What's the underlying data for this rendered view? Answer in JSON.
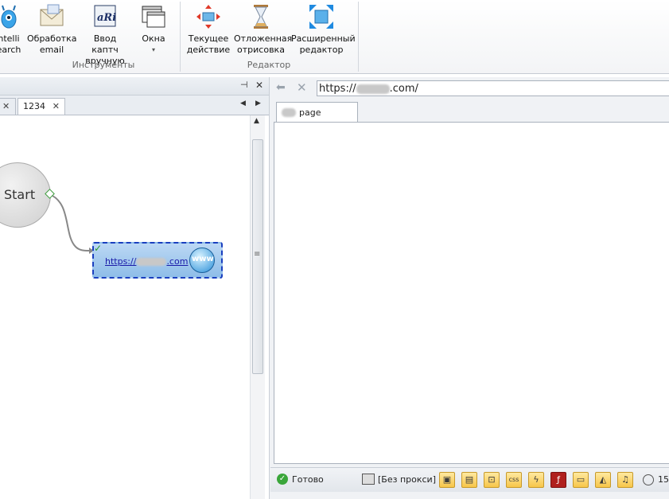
{
  "ribbon": {
    "tools_group": {
      "label": "Инструменты",
      "buttons": [
        {
          "line1": "ntelli",
          "line2": "earch",
          "icon": "intellisearch-icon"
        },
        {
          "line1": "Обработка",
          "line2": "email",
          "icon": "email-envelope-icon"
        },
        {
          "line1": "Ввод каптч",
          "line2": "вручную",
          "icon": "captcha-icon"
        },
        {
          "line1": "Окна",
          "line2": "▾",
          "icon": "windows-icon"
        }
      ]
    },
    "editor_group": {
      "label": "Редактор",
      "buttons": [
        {
          "line1": "Текущее",
          "line2": "действие",
          "icon": "current-action-icon"
        },
        {
          "line1": "Отложенная",
          "line2": "отрисовка",
          "icon": "hourglass-icon"
        },
        {
          "line1": "Расширенный",
          "line2": "редактор",
          "icon": "expand-arrows-icon"
        }
      ]
    }
  },
  "left_panel": {
    "pin_glyph": "⊣",
    "close_glyph": "✕",
    "tab_close_glyph": "✕",
    "tabs": [
      {
        "label": "",
        "close": "✕"
      },
      {
        "label": "1234",
        "close": "✕"
      }
    ],
    "nav_prev": "◀",
    "nav_next": "▶",
    "scroll_up": "▲",
    "scroll_grip": "≡",
    "start_node": "Start",
    "url_node": {
      "prefix": "https://",
      "suffix": ".com",
      "badge": "www"
    }
  },
  "browser": {
    "back_glyph": "⬅",
    "stop_glyph": "✕",
    "url_prefix": "https://",
    "url_suffix": ".com/",
    "tab_label": "page"
  },
  "status_bar": {
    "status": "Готово",
    "proxy": "[Без прокси]",
    "time_prefix": "15",
    "icons": [
      "image-icon",
      "window-icon",
      "frames-icon",
      "css-icon",
      "lightning-icon",
      "flash-icon",
      "media-player-icon",
      "flag-icon",
      "music-icon"
    ]
  },
  "colors": {
    "accent": "#1a4fd0",
    "node_fill": "#9ec4ea",
    "status_ok": "#3aa63a"
  }
}
